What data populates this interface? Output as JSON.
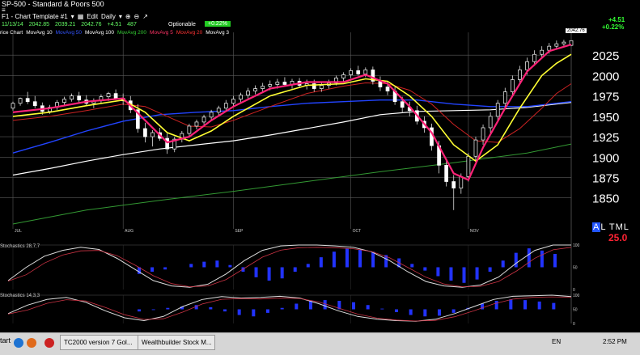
{
  "header": {
    "symbol_line": "SP-500  -  Standard & Poors 500",
    "sub_line": "≡",
    "template": "F1 - Chart Template #1",
    "edit_label": "Edit",
    "interval": "Daily",
    "quote": [
      "11/13/14",
      "2042.85",
      "2039.21",
      "2042.76",
      "+4.51",
      "487"
    ],
    "optionable_label": "Optionable",
    "optionable_badge": "+0.22%",
    "ma_legend": [
      {
        "label": "rice Chart",
        "color": "#ffffff"
      },
      {
        "label": "MovAvg 10",
        "color": "#ffffff"
      },
      {
        "label": "MovAvg 50",
        "color": "#3355ff"
      },
      {
        "label": "MovAvg 100",
        "color": "#ffffff"
      },
      {
        "label": "MovAvg 200",
        "color": "#33cc33"
      },
      {
        "label": "MovAvg 5",
        "color": "#ff3366"
      },
      {
        "label": "MovAvg 20",
        "color": "#ff3333"
      },
      {
        "label": "MovAvg 3",
        "color": "#ffffff"
      }
    ]
  },
  "change_abs": "+4.51",
  "change_pct": "+0.22%",
  "last_price_badge": "2042.76",
  "altml": {
    "hl": "A",
    "rest": "L TML",
    "value": "25.0"
  },
  "colors": {
    "up": "#ffffff",
    "down": "#ffffff",
    "ma5": "#ff2277",
    "ma10": "#ffff33",
    "ma20": "#cc2222",
    "ma50": "#2244ff",
    "ma100": "#ffffff",
    "ma200": "#339933",
    "grid": "#5a5a5a",
    "hist": "#2233ff"
  },
  "chart_data": {
    "type": "candlestick",
    "title": "SP-500 - Standard & Poors 500",
    "x_months": [
      "JUL",
      "AUG",
      "SEP",
      "OCT",
      "NOV"
    ],
    "y_ticks": [
      1850,
      1875,
      1900,
      1925,
      1950,
      1975,
      2000,
      2025
    ],
    "ylim": [
      1812,
      2053
    ],
    "grid": true,
    "candles": [
      [
        1960,
        1968,
        1957,
        1966
      ],
      [
        1966,
        1973,
        1963,
        1972
      ],
      [
        1972,
        1980,
        1965,
        1968
      ],
      [
        1968,
        1975,
        1960,
        1963
      ],
      [
        1963,
        1967,
        1952,
        1956
      ],
      [
        1956,
        1964,
        1953,
        1961
      ],
      [
        1961,
        1970,
        1958,
        1967
      ],
      [
        1967,
        1974,
        1964,
        1971
      ],
      [
        1971,
        1978,
        1968,
        1975
      ],
      [
        1975,
        1980,
        1966,
        1970
      ],
      [
        1970,
        1976,
        1963,
        1966
      ],
      [
        1966,
        1972,
        1960,
        1969
      ],
      [
        1969,
        1977,
        1966,
        1974
      ],
      [
        1974,
        1980,
        1969,
        1978
      ],
      [
        1978,
        1983,
        1970,
        1972
      ],
      [
        1972,
        1978,
        1964,
        1969
      ],
      [
        1969,
        1975,
        1954,
        1958
      ],
      [
        1958,
        1965,
        1930,
        1935
      ],
      [
        1935,
        1942,
        1918,
        1925
      ],
      [
        1925,
        1933,
        1913,
        1930
      ],
      [
        1930,
        1936,
        1920,
        1923
      ],
      [
        1923,
        1929,
        1904,
        1910
      ],
      [
        1910,
        1925,
        1906,
        1922
      ],
      [
        1922,
        1932,
        1918,
        1929
      ],
      [
        1929,
        1941,
        1926,
        1938
      ],
      [
        1938,
        1946,
        1934,
        1943
      ],
      [
        1943,
        1952,
        1940,
        1949
      ],
      [
        1949,
        1958,
        1946,
        1955
      ],
      [
        1955,
        1963,
        1951,
        1960
      ],
      [
        1960,
        1970,
        1957,
        1966
      ],
      [
        1966,
        1975,
        1962,
        1971
      ],
      [
        1971,
        1979,
        1967,
        1976
      ],
      [
        1976,
        1985,
        1972,
        1981
      ],
      [
        1981,
        1988,
        1977,
        1984
      ],
      [
        1984,
        1991,
        1979,
        1987
      ],
      [
        1987,
        1994,
        1982,
        1989
      ],
      [
        1989,
        1996,
        1984,
        1992
      ],
      [
        1992,
        1998,
        1986,
        1989
      ],
      [
        1989,
        1996,
        1984,
        1993
      ],
      [
        1993,
        1997,
        1985,
        1988
      ],
      [
        1988,
        1995,
        1983,
        1990
      ],
      [
        1990,
        1995,
        1980,
        1984
      ],
      [
        1984,
        1992,
        1980,
        1988
      ],
      [
        1988,
        1995,
        1984,
        1991
      ],
      [
        1991,
        2000,
        1988,
        1997
      ],
      [
        1997,
        2004,
        1993,
        2001
      ],
      [
        2001,
        2009,
        1997,
        2006
      ],
      [
        2006,
        2012,
        2000,
        2002
      ],
      [
        2002,
        2010,
        1998,
        2007
      ],
      [
        2007,
        2011,
        1989,
        1993
      ],
      [
        1993,
        1999,
        1981,
        1986
      ],
      [
        1986,
        1993,
        1976,
        1981
      ],
      [
        1981,
        1986,
        1964,
        1968
      ],
      [
        1968,
        1974,
        1955,
        1961
      ],
      [
        1961,
        1968,
        1950,
        1957
      ],
      [
        1957,
        1963,
        1940,
        1944
      ],
      [
        1944,
        1950,
        1930,
        1936
      ],
      [
        1936,
        1941,
        1908,
        1914
      ],
      [
        1914,
        1920,
        1880,
        1890
      ],
      [
        1890,
        1896,
        1864,
        1870
      ],
      [
        1870,
        1878,
        1835,
        1862
      ],
      [
        1862,
        1880,
        1855,
        1876
      ],
      [
        1876,
        1905,
        1870,
        1901
      ],
      [
        1901,
        1925,
        1895,
        1921
      ],
      [
        1921,
        1940,
        1915,
        1936
      ],
      [
        1936,
        1955,
        1930,
        1950
      ],
      [
        1950,
        1970,
        1945,
        1966
      ],
      [
        1966,
        1985,
        1960,
        1980
      ],
      [
        1980,
        2000,
        1975,
        1995
      ],
      [
        1995,
        2012,
        1990,
        2007
      ],
      [
        2007,
        2022,
        2001,
        2017
      ],
      [
        2017,
        2031,
        2012,
        2026
      ],
      [
        2026,
        2036,
        2021,
        2031
      ],
      [
        2031,
        2040,
        2027,
        2036
      ],
      [
        2036,
        2043,
        2032,
        2039
      ],
      [
        2039,
        2044,
        2035,
        2041
      ],
      [
        2037,
        2043,
        2036,
        2042.76
      ]
    ],
    "ma_lines": {
      "ma5": [
        [
          0,
          1955
        ],
        [
          5,
          1960
        ],
        [
          10,
          1968
        ],
        [
          15,
          1972
        ],
        [
          18,
          1945
        ],
        [
          21,
          1918
        ],
        [
          24,
          1925
        ],
        [
          27,
          1945
        ],
        [
          30,
          1962
        ],
        [
          35,
          1984
        ],
        [
          40,
          1992
        ],
        [
          45,
          1992
        ],
        [
          48,
          2001
        ],
        [
          51,
          1990
        ],
        [
          54,
          1962
        ],
        [
          57,
          1930
        ],
        [
          60,
          1880
        ],
        [
          62,
          1872
        ],
        [
          64,
          1912
        ],
        [
          67,
          1960
        ],
        [
          70,
          2005
        ],
        [
          73,
          2030
        ],
        [
          76,
          2038
        ]
      ],
      "ma10": [
        [
          0,
          1950
        ],
        [
          5,
          1955
        ],
        [
          10,
          1963
        ],
        [
          15,
          1970
        ],
        [
          18,
          1955
        ],
        [
          21,
          1930
        ],
        [
          24,
          1920
        ],
        [
          27,
          1932
        ],
        [
          30,
          1950
        ],
        [
          35,
          1975
        ],
        [
          40,
          1988
        ],
        [
          45,
          1990
        ],
        [
          48,
          1996
        ],
        [
          51,
          1993
        ],
        [
          54,
          1975
        ],
        [
          57,
          1950
        ],
        [
          60,
          1915
        ],
        [
          63,
          1895
        ],
        [
          66,
          1915
        ],
        [
          69,
          1960
        ],
        [
          72,
          2000
        ],
        [
          74,
          2015
        ],
        [
          76,
          2026
        ]
      ],
      "ma20": [
        [
          0,
          1945
        ],
        [
          5,
          1950
        ],
        [
          10,
          1957
        ],
        [
          15,
          1965
        ],
        [
          18,
          1962
        ],
        [
          21,
          1950
        ],
        [
          24,
          1938
        ],
        [
          27,
          1937
        ],
        [
          30,
          1945
        ],
        [
          35,
          1962
        ],
        [
          40,
          1978
        ],
        [
          45,
          1987
        ],
        [
          48,
          1991
        ],
        [
          51,
          1990
        ],
        [
          54,
          1982
        ],
        [
          57,
          1965
        ],
        [
          60,
          1940
        ],
        [
          63,
          1920
        ],
        [
          66,
          1918
        ],
        [
          69,
          1935
        ],
        [
          72,
          1960
        ],
        [
          74,
          1978
        ],
        [
          76,
          1990
        ]
      ],
      "ma50": [
        [
          0,
          1905
        ],
        [
          5,
          1918
        ],
        [
          10,
          1932
        ],
        [
          15,
          1944
        ],
        [
          20,
          1952
        ],
        [
          25,
          1955
        ],
        [
          30,
          1957
        ],
        [
          35,
          1962
        ],
        [
          40,
          1966
        ],
        [
          45,
          1968
        ],
        [
          50,
          1970
        ],
        [
          55,
          1970
        ],
        [
          60,
          1965
        ],
        [
          65,
          1962
        ],
        [
          70,
          1962
        ],
        [
          74,
          1966
        ],
        [
          76,
          1968
        ]
      ],
      "ma100": [
        [
          0,
          1878
        ],
        [
          5,
          1886
        ],
        [
          10,
          1895
        ],
        [
          15,
          1903
        ],
        [
          20,
          1910
        ],
        [
          25,
          1915
        ],
        [
          30,
          1920
        ],
        [
          35,
          1927
        ],
        [
          40,
          1935
        ],
        [
          45,
          1943
        ],
        [
          50,
          1952
        ],
        [
          55,
          1956
        ],
        [
          60,
          1957
        ],
        [
          65,
          1958
        ],
        [
          70,
          1961
        ],
        [
          74,
          1965
        ],
        [
          76,
          1967
        ]
      ],
      "ma200": [
        [
          0,
          1818
        ],
        [
          10,
          1835
        ],
        [
          20,
          1847
        ],
        [
          30,
          1858
        ],
        [
          40,
          1870
        ],
        [
          50,
          1882
        ],
        [
          60,
          1893
        ],
        [
          70,
          1905
        ],
        [
          76,
          1916
        ]
      ]
    },
    "indicators": [
      {
        "label": "Stochastics 28,7,7",
        "y_ticks": [
          100,
          50,
          0
        ],
        "k": [
          20,
          50,
          75,
          88,
          95,
          90,
          70,
          45,
          20,
          8,
          5,
          12,
          35,
          65,
          88,
          98,
          100,
          100,
          98,
          95,
          85,
          65,
          40,
          18,
          8,
          5,
          10,
          28,
          60,
          88,
          100,
          100
        ],
        "hist": [
          -6,
          -4,
          -2,
          0,
          3,
          5,
          6,
          2,
          -4,
          -9,
          -12,
          -10,
          -4,
          3,
          9,
          14,
          17,
          16,
          14,
          11,
          8,
          3,
          -3,
          -8,
          -12,
          -14,
          -11,
          -4,
          6,
          13,
          17,
          15,
          12
        ]
      },
      {
        "label": "Stochastics 14,3,3",
        "y_ticks": [
          100,
          50,
          0
        ],
        "k": [
          35,
          65,
          85,
          92,
          75,
          45,
          20,
          10,
          25,
          60,
          85,
          95,
          90,
          92,
          96,
          90,
          70,
          45,
          25,
          15,
          10,
          8,
          15,
          35,
          60,
          85,
          96,
          98,
          100,
          95
        ],
        "hist": [
          -3,
          -1,
          2,
          4,
          6,
          3,
          -3,
          -8,
          -10,
          -5,
          2,
          8,
          12,
          13,
          12,
          10,
          6,
          1,
          -4,
          -8,
          -10,
          -9,
          -5,
          2,
          8,
          12,
          14,
          13,
          11,
          9
        ]
      }
    ]
  },
  "taskbar": {
    "start": "tart",
    "items": [
      "TC2000 version 7 Gol...",
      "Wealthbuilder Stock M..."
    ],
    "lang": "EN",
    "clock": "2:52 PM"
  }
}
